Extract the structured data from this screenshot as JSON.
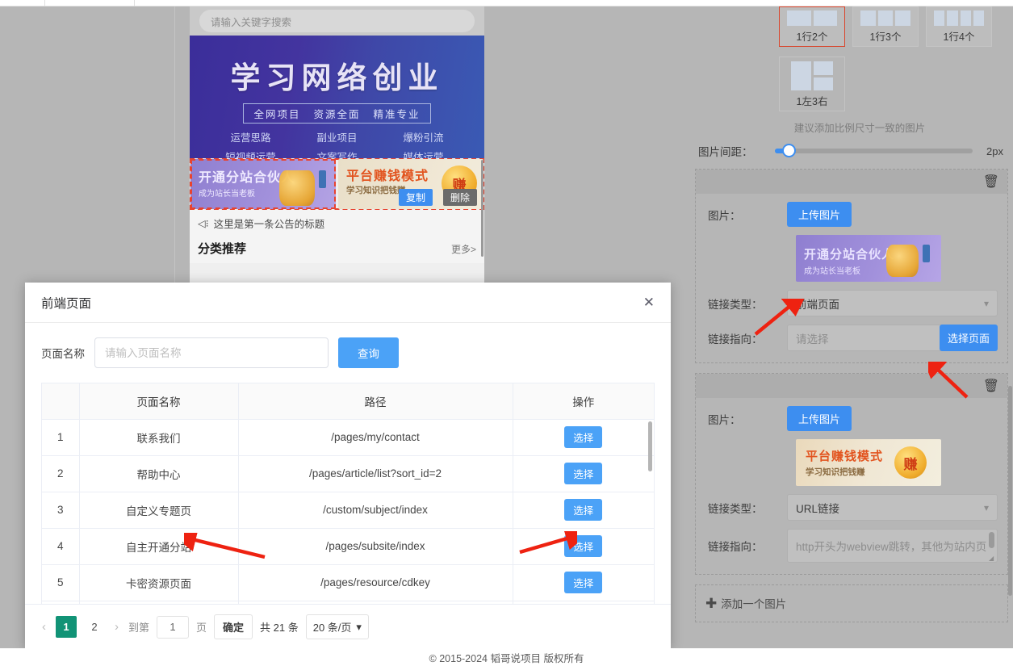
{
  "phone_preview": {
    "search_placeholder": "请输入关键字搜索",
    "hero_title": "学习网络创业",
    "hero_tags": [
      "全网项目",
      "资源全面",
      "精准专业"
    ],
    "hero_links": [
      "运营思路",
      "副业项目",
      "爆粉引流",
      "短视频运营",
      "文案写作",
      "媒体运营"
    ],
    "banner1_title": "开通分站合伙人",
    "banner1_sub": "成为站长当老板",
    "banner2_title": "平台赚钱模式",
    "banner2_sub": "学习知识把钱赚",
    "copy_label": "复制",
    "delete_label": "删除",
    "notice_text": "这里是第一条公告的标题",
    "section_title": "分类推荐",
    "section_more": "更多>"
  },
  "right_panel": {
    "layout_options": [
      {
        "label": "1行2个",
        "selected": true
      },
      {
        "label": "1行3个",
        "selected": false
      },
      {
        "label": "1行4个",
        "selected": false
      }
    ],
    "layout_option_special": {
      "label": "1左3右",
      "selected": false
    },
    "hint": "建议添加比例尺寸一致的图片",
    "spacing_label": "图片间距：",
    "spacing_value": "2px",
    "cards": [
      {
        "image_label": "图片：",
        "upload_label": "上传图片",
        "thumb_title": "开通分站合伙人",
        "thumb_sub": "成为站长当老板",
        "link_type_label": "链接类型：",
        "link_type_value": "前端页面",
        "link_target_label": "链接指向：",
        "link_target_placeholder": "请选择",
        "select_page_label": "选择页面"
      },
      {
        "image_label": "图片：",
        "upload_label": "上传图片",
        "thumb_title": "平台赚钱模式",
        "thumb_sub": "学习知识把钱赚",
        "link_type_label": "链接类型：",
        "link_type_value": "URL链接",
        "link_target_label": "链接指向：",
        "link_target_placeholder": "http开头为webview跳转，其他为站内页"
      }
    ],
    "add_image_label": "添加一个图片",
    "delete_icon": "trash-icon"
  },
  "dialog": {
    "title": "前端页面",
    "close_icon": "close-icon",
    "search_label": "页面名称",
    "search_placeholder": "请输入页面名称",
    "search_value": "",
    "query_button": "查询",
    "table": {
      "headers": [
        "",
        "页面名称",
        "路径",
        "操作"
      ],
      "action_label": "选择",
      "rows": [
        {
          "index": "1",
          "name": "联系我们",
          "path": "/pages/my/contact"
        },
        {
          "index": "2",
          "name": "帮助中心",
          "path": "/pages/article/list?sort_id=2"
        },
        {
          "index": "3",
          "name": "自定义专题页",
          "path": "/custom/subject/index"
        },
        {
          "index": "4",
          "name": "自主开通分站",
          "path": "/pages/subsite/index"
        },
        {
          "index": "5",
          "name": "卡密资源页面",
          "path": "/pages/resource/cdkey"
        }
      ]
    },
    "pagination": {
      "prev_icon": "chevron-left-icon",
      "next_icon": "chevron-right-icon",
      "pages": [
        "1",
        "2"
      ],
      "current_page": "1",
      "goto_label": "到第",
      "goto_value": "1",
      "page_unit": "页",
      "confirm_label": "确定",
      "total_label": "共 21 条",
      "page_size_label": "20 条/页"
    }
  },
  "footer": {
    "copyright": "© 2015-2024 韬哥说项目 版权所有"
  },
  "colors": {
    "primary_blue": "#4ba2f7",
    "accent_red": "#e8432f",
    "pager_active": "#119376"
  }
}
